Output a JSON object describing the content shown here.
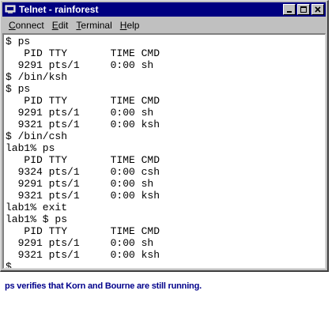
{
  "window": {
    "title": "Telnet - rainforest",
    "buttons": [
      "minimize",
      "maximize",
      "close"
    ]
  },
  "menu": [
    {
      "mnemonic": "C",
      "rest": "onnect"
    },
    {
      "mnemonic": "E",
      "rest": "dit"
    },
    {
      "mnemonic": "T",
      "rest": "erminal"
    },
    {
      "mnemonic": "H",
      "rest": "elp"
    }
  ],
  "terminal_lines": [
    "$ ps",
    "   PID TTY       TIME CMD",
    "  9291 pts/1     0:00 sh",
    "$ /bin/ksh",
    "$ ps",
    "   PID TTY       TIME CMD",
    "  9291 pts/1     0:00 sh",
    "  9321 pts/1     0:00 ksh",
    "$ /bin/csh",
    "lab1% ps",
    "   PID TTY       TIME CMD",
    "  9324 pts/1     0:00 csh",
    "  9291 pts/1     0:00 sh",
    "  9321 pts/1     0:00 ksh",
    "lab1% exit",
    "lab1% $ ps",
    "   PID TTY       TIME CMD",
    "  9291 pts/1     0:00 sh",
    "  9321 pts/1     0:00 ksh",
    "$"
  ],
  "caption": "ps verifies that Korn and Bourne are still running.",
  "colors": {
    "titlebar": "#000080",
    "chrome": "#c0c0c0",
    "caption": "#00008b"
  },
  "icons": {
    "app": "telnet-app-icon",
    "minimize": "minimize-icon",
    "maximize": "maximize-icon",
    "close": "close-icon"
  }
}
